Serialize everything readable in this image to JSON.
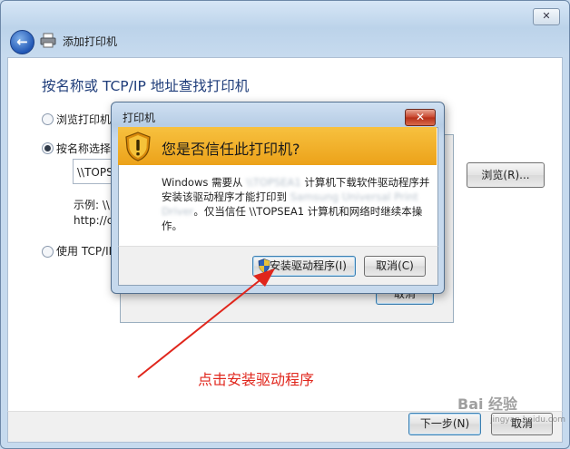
{
  "wizard": {
    "title": "添加打印机",
    "close_glyph": "✕",
    "heading": "按名称或 TCP/IP 地址查找打印机",
    "options": [
      {
        "label": "浏览打印机",
        "checked": false
      },
      {
        "label": "按名称选择",
        "checked": true
      },
      {
        "label": "使用 TCP/IP",
        "checked": false
      }
    ],
    "path_value": "\\\\TOPS",
    "browse_label": "浏览(R)...",
    "example_line1": "示例: \\\\",
    "example_line2": "http://c",
    "next_label": "下一步(N)",
    "cancel_label": "取消"
  },
  "background_dialog": {
    "cancel_label": "取消"
  },
  "trust_dialog": {
    "title": "打印机",
    "close_glyph": "✕",
    "heading": "您是否信任此打印机?",
    "message_part1": "Windows 需要从 ",
    "message_blur1": "\\\\TOPSEA1",
    "message_part2": " 计算机下载软件驱动程序并安装该驱动程序才能打印到 ",
    "message_blur2": "Samsung Universal Print Driver",
    "message_part3": "。仅当信任 \\\\TOPSEA1 计算机和网络时继续本操作。",
    "install_label": "安装驱动程序(I)",
    "cancel_label": "取消(C)"
  },
  "annotation": {
    "text": "点击安装驱动程序",
    "color": "#e0261c"
  },
  "watermark": {
    "text": "Bai 经验",
    "sub": "jingyan.baidu.com"
  },
  "colors": {
    "heading": "#1f3d7a",
    "warning_band": "#f0aa22"
  }
}
